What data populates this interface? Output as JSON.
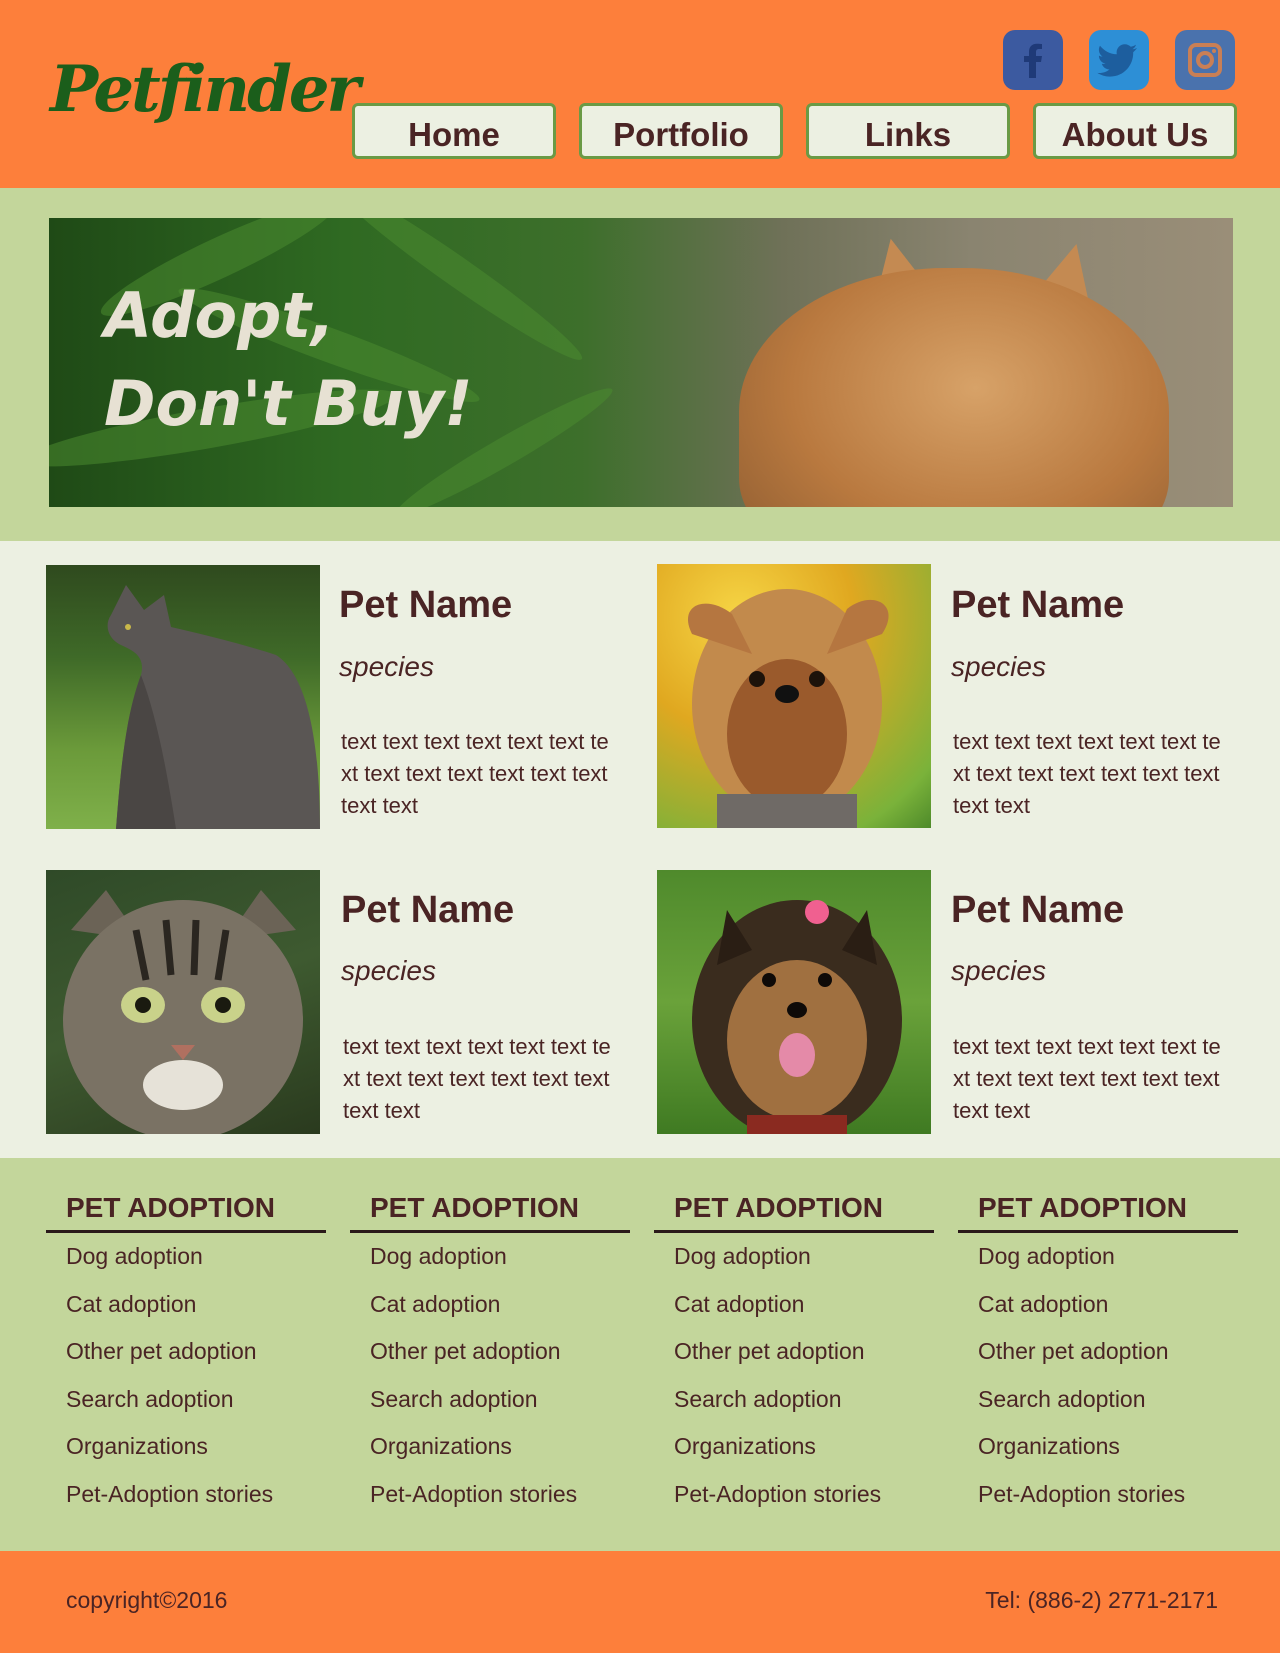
{
  "header": {
    "logo": "Petfinder",
    "social": [
      "facebook-icon",
      "twitter-icon",
      "instagram-icon"
    ],
    "nav": [
      "Home",
      "Portfolio",
      "Links",
      "About Us"
    ]
  },
  "hero": {
    "line1": "Adopt,",
    "line2": "Don't Buy!"
  },
  "pets": [
    {
      "name": "Pet Name",
      "species": "species",
      "desc": "text text text text text text text text text text text text text text text",
      "image": "gray-cat-photo"
    },
    {
      "name": "Pet Name",
      "species": "species",
      "desc": "text text text text text text text text text text text text text text text",
      "image": "yorkie-dog-photo"
    },
    {
      "name": "Pet Name",
      "species": "species",
      "desc": "text text text text text text text text text text text text text text text",
      "image": "tabby-cat-photo"
    },
    {
      "name": "Pet Name",
      "species": "species",
      "desc": "text text text text text text text text text text text text text text text",
      "image": "yorkie-bow-dog-photo"
    }
  ],
  "footer_columns": [
    {
      "title": "PET ADOPTION",
      "items": [
        "Dog adoption",
        "Cat adoption",
        "Other pet adoption",
        "Search adoption",
        "Organizations",
        "Pet-Adoption stories"
      ]
    },
    {
      "title": "PET ADOPTION",
      "items": [
        "Dog adoption",
        "Cat adoption",
        "Other pet adoption",
        "Search adoption",
        "Organizations",
        "Pet-Adoption stories"
      ]
    },
    {
      "title": "PET ADOPTION",
      "items": [
        "Dog adoption",
        "Cat adoption",
        "Other pet adoption",
        "Search adoption",
        "Organizations",
        "Pet-Adoption stories"
      ]
    },
    {
      "title": "PET ADOPTION",
      "items": [
        "Dog adoption",
        "Cat adoption",
        "Other pet adoption",
        "Search adoption",
        "Organizations",
        "Pet-Adoption stories"
      ]
    }
  ],
  "bottom": {
    "copyright": "copyright©2016",
    "tel": "Tel: (886-2) 2771-2171"
  },
  "colors": {
    "orange": "#fd7f3b",
    "green_band": "#c3d69b",
    "cream": "#ecf0e2",
    "text": "#4a2424",
    "logo_green": "#1b5e1b"
  }
}
